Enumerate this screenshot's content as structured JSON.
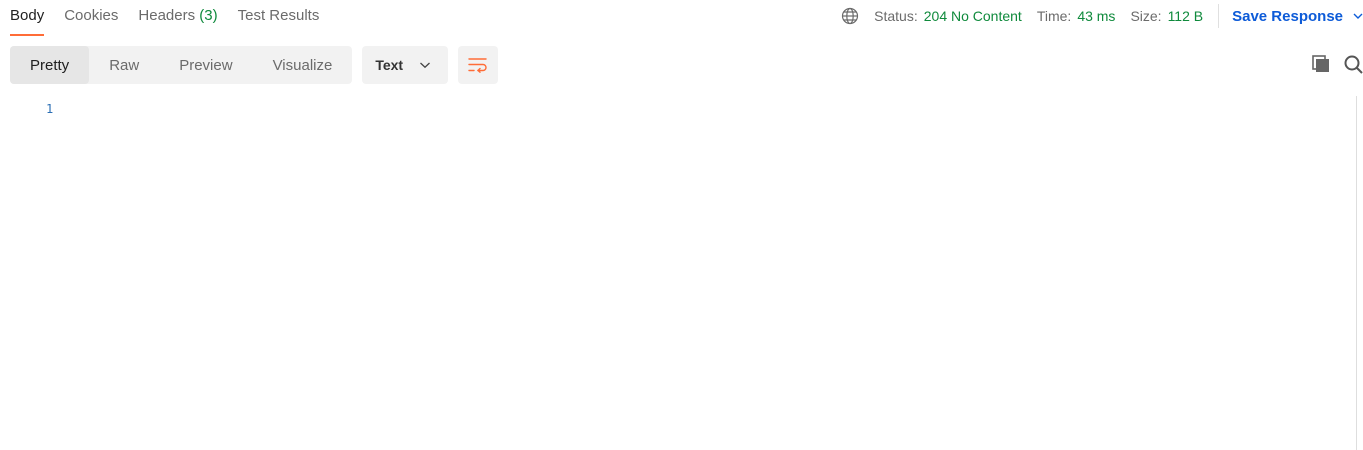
{
  "tabs": [
    {
      "label": "Body",
      "active": true
    },
    {
      "label": "Cookies"
    },
    {
      "label": "Headers",
      "count": "(3)"
    },
    {
      "label": "Test Results"
    }
  ],
  "status": {
    "status_label": "Status:",
    "status_value": "204 No Content",
    "time_label": "Time:",
    "time_value": "43 ms",
    "size_label": "Size:",
    "size_value": "112 B",
    "save_label": "Save Response",
    "globe_icon": "globe-icon"
  },
  "view_modes": [
    "Pretty",
    "Raw",
    "Preview",
    "Visualize"
  ],
  "active_view_mode": "Pretty",
  "format_select": "Text",
  "editor": {
    "line_numbers": [
      "1"
    ]
  },
  "colors": {
    "accent": "#ff6c37",
    "status_ok": "#0f8a3c",
    "link": "#0d5bd8"
  }
}
